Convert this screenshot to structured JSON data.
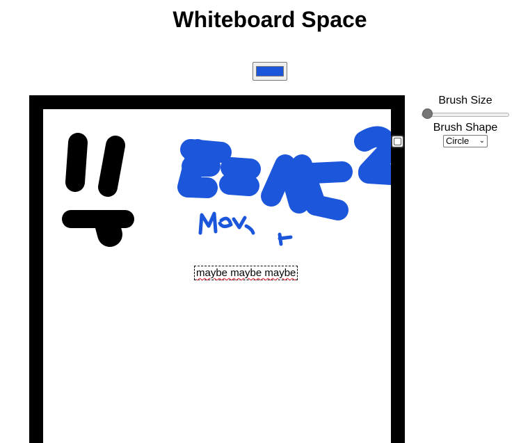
{
  "page": {
    "title": "Whiteboard Space"
  },
  "toolbar": {
    "brush_color": "#1c56db"
  },
  "board": {
    "background": "#ffffff",
    "frame_color": "#000000",
    "text_box": "maybe maybe maybe"
  },
  "controls": {
    "brush_size_label": "Brush Size",
    "brush_size_value": 0.05,
    "brush_shape_label": "Brush Shape",
    "brush_shape_selected": "Circle"
  },
  "icons": {
    "select_arrow": "chevron-down-icon"
  }
}
